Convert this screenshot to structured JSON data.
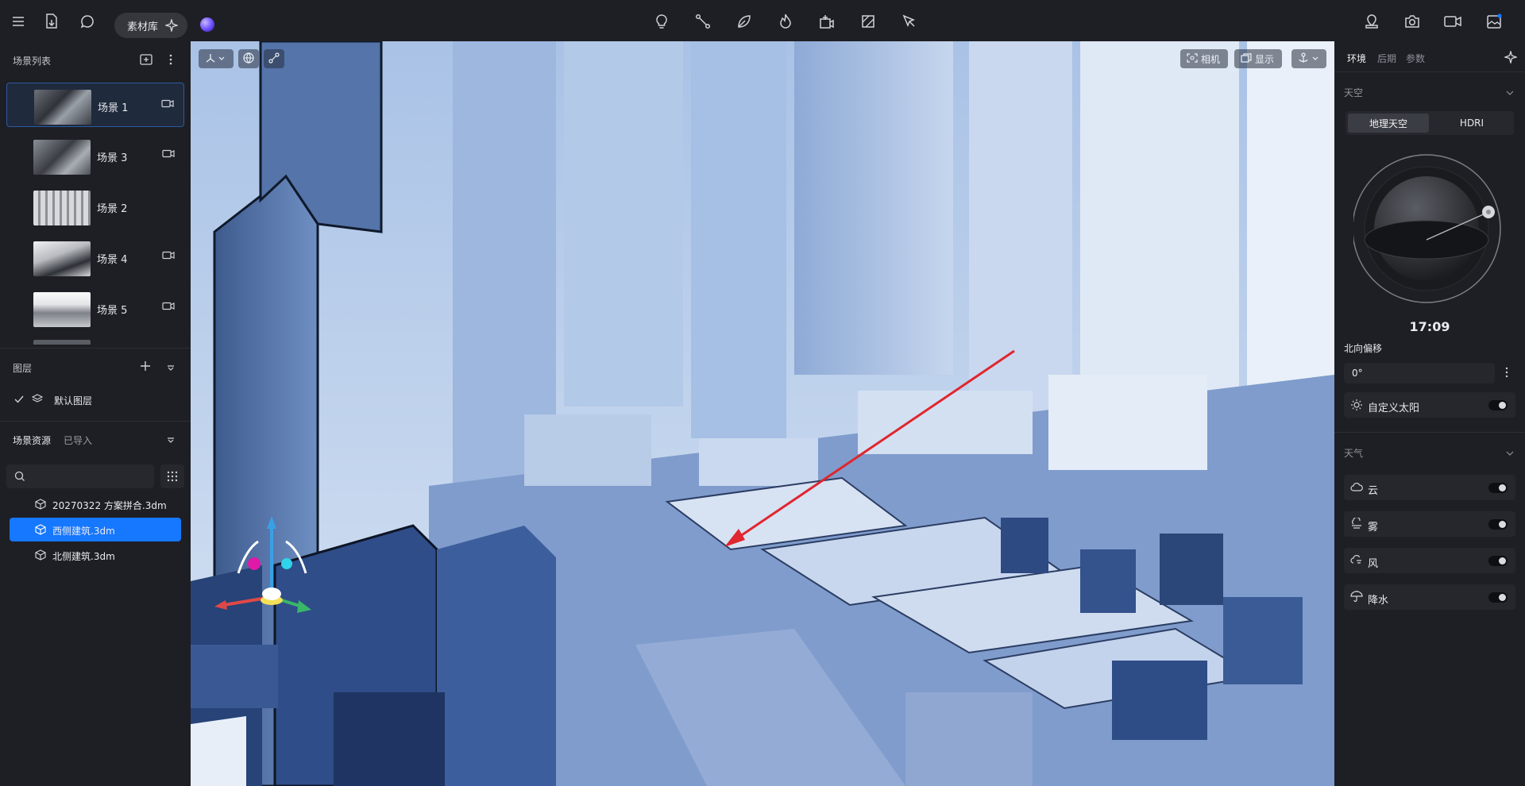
{
  "toolbar": {
    "library_label": "素材库"
  },
  "left": {
    "scene_list_title": "场景列表",
    "scenes": [
      {
        "name": "场景 1",
        "active": true
      },
      {
        "name": "场景 3",
        "active": false
      },
      {
        "name": "场景 2",
        "active": false
      },
      {
        "name": "场景 4",
        "active": false
      },
      {
        "name": "场景 5",
        "active": false
      }
    ],
    "layers_title": "图层",
    "default_layer": "默认图层",
    "assets_tab": "场景资源",
    "imported_tab": "已导入",
    "search_placeholder": "",
    "assets": [
      {
        "name": "20270322 方案拼合.3dm",
        "active": false
      },
      {
        "name": "西侧建筑.3dm",
        "active": true
      },
      {
        "name": "北侧建筑.3dm",
        "active": false
      }
    ]
  },
  "viewport": {
    "camera_label": "相机",
    "display_label": "显示"
  },
  "right": {
    "tabs": [
      "环境",
      "后期",
      "参数"
    ],
    "sky_title": "天空",
    "sky_seg": [
      "地理天空",
      "HDRI"
    ],
    "time": "17:09",
    "north_offset_label": "北向偏移",
    "north_offset_value": "0°",
    "custom_sun_label": "自定义太阳",
    "weather_title": "天气",
    "weather_items": [
      "云",
      "雾",
      "风",
      "降水"
    ]
  },
  "colors": {
    "accent": "#1677ff",
    "panel": "#1e1f24",
    "arrow": "#e0262e"
  }
}
